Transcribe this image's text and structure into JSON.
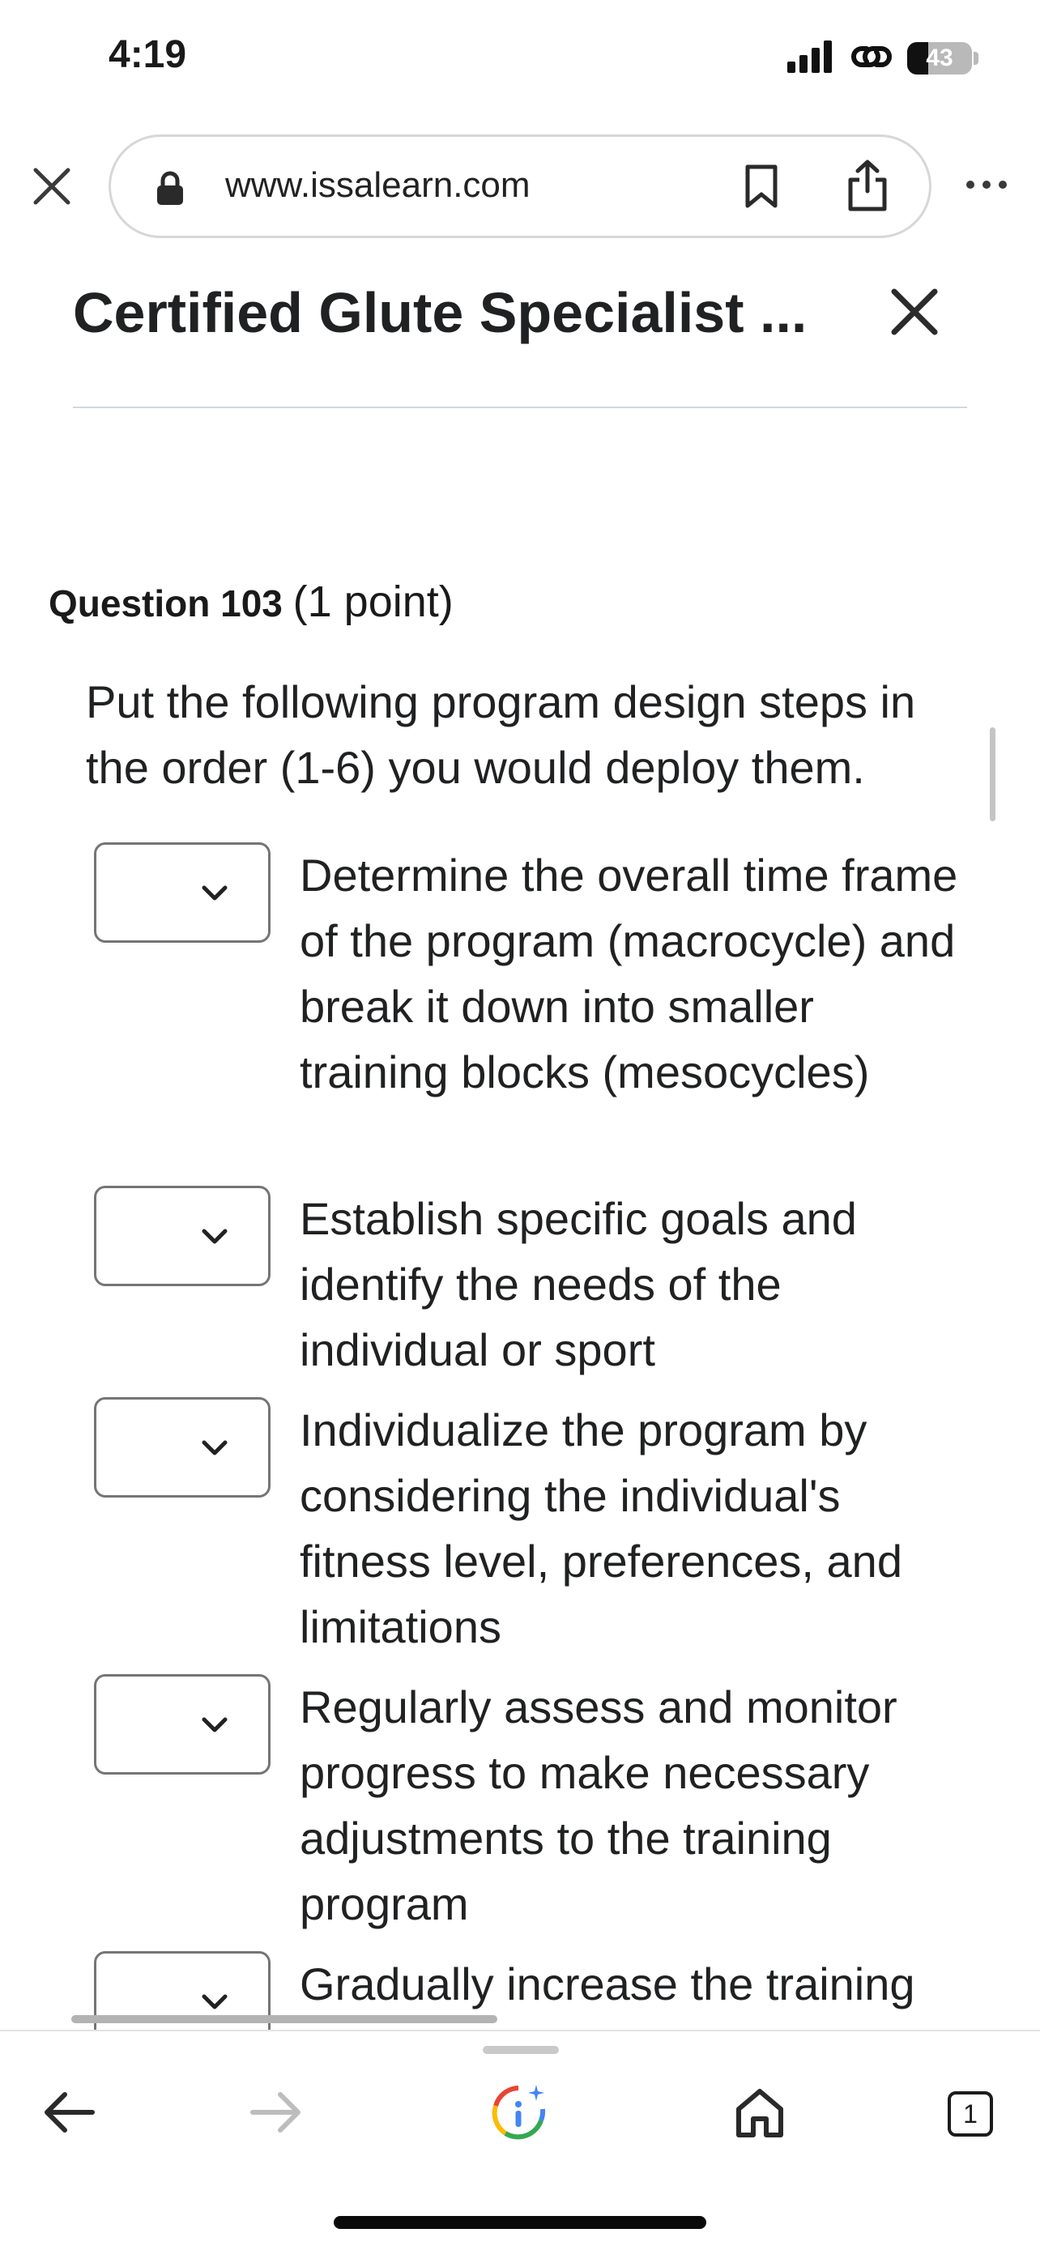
{
  "status_bar": {
    "time": "4:19",
    "battery": "43"
  },
  "browser": {
    "url": "www.issalearn.com",
    "open_tabs": "1"
  },
  "page": {
    "title": "Certified Glute Specialist ..."
  },
  "question": {
    "number_label": "Question 103",
    "points_label": "(1 point)",
    "prompt": "Put the following program design steps in the order (1-6) you would deploy them.",
    "items": [
      {
        "selected": "",
        "text": "Determine the overall time frame of the program (macrocycle) and break it down into smaller training blocks (mesocycles)"
      },
      {
        "selected": "",
        "text": "Establish specific goals and identify the needs of the individual or sport"
      },
      {
        "selected": "",
        "text": "Individualize the program by considering the individual's fitness level, preferences, and limitations"
      },
      {
        "selected": "",
        "text": "Regularly assess and monitor progress to make necessary adjustments to the training program"
      },
      {
        "selected": "",
        "text": "Gradually increase the training"
      }
    ]
  },
  "icons": {
    "close_tab": "close-icon",
    "lock": "lock-icon",
    "bookmark": "bookmark-icon",
    "share": "share-icon",
    "more": "more-icon",
    "close_course": "close-icon",
    "dropdown": "chevron-down-icon",
    "back": "arrow-left-icon",
    "forward": "arrow-right-icon",
    "google": "google-lens-icon",
    "home": "home-icon"
  }
}
